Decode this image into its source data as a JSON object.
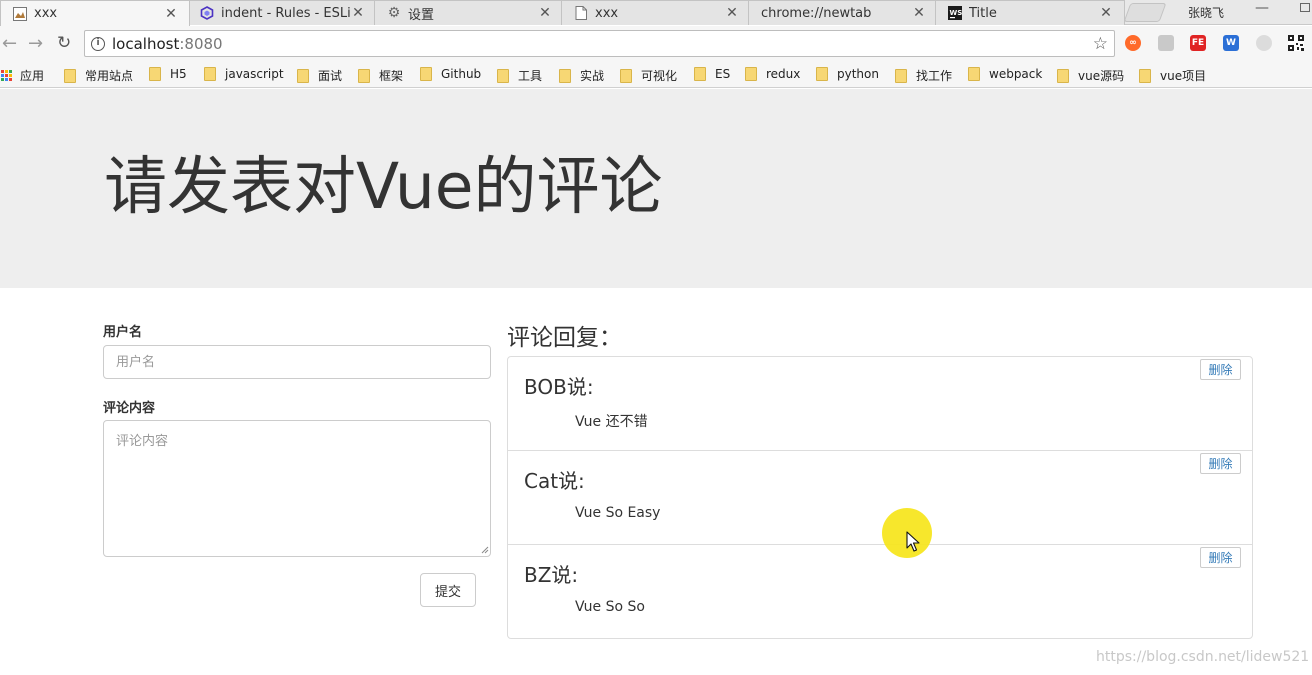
{
  "browser": {
    "tabs": [
      {
        "title": "xxx",
        "active": true
      },
      {
        "title": "indent - Rules - ESLint",
        "active": false
      },
      {
        "title": "设置",
        "active": false
      },
      {
        "title": "xxx",
        "active": false
      },
      {
        "title": "chrome://newtab",
        "active": false
      },
      {
        "title": "Title",
        "active": false
      }
    ],
    "window_user": "张晓飞",
    "address": {
      "host": "localhost",
      "port": ":8080"
    },
    "bookmarks": [
      "应用",
      "常用站点",
      "H5",
      "javascript",
      "面试",
      "框架",
      "Github",
      "工具",
      "实战",
      "可视化",
      "ES",
      "redux",
      "python",
      "找工作",
      "webpack",
      "vue源码",
      "vue项目"
    ]
  },
  "page": {
    "heading": "请发表对Vue的评论",
    "form": {
      "username_label": "用户名",
      "username_placeholder": "用户名",
      "username_value": "",
      "content_label": "评论内容",
      "content_placeholder": "评论内容",
      "content_value": "",
      "submit_label": "提交"
    },
    "comments": {
      "title": "评论回复：",
      "delete_label": "删除",
      "items": [
        {
          "user": "BOB说:",
          "content": "Vue 还不错"
        },
        {
          "user": "Cat说:",
          "content": "Vue So Easy"
        },
        {
          "user": "BZ说:",
          "content": "Vue So So"
        }
      ]
    }
  },
  "watermark": "https://blog.csdn.net/lidew521",
  "colors": {
    "link": "#337ab7",
    "jumbotron": "#eeeeee",
    "cursor_highlight": "#f6e51a"
  }
}
